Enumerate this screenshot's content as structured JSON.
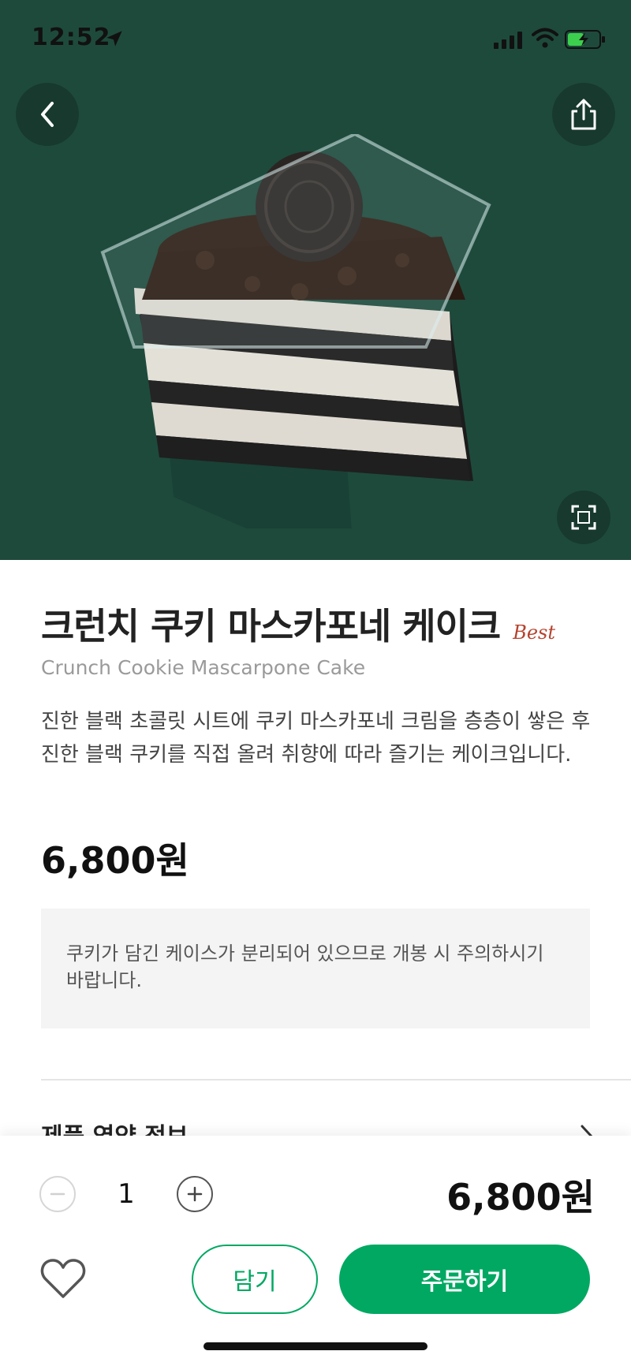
{
  "status_bar": {
    "time": "12:52"
  },
  "product": {
    "name_ko": "크런치 쿠키 마스카포네 케이크",
    "badge": "Best",
    "name_en": "Crunch Cookie Mascarpone Cake",
    "description": "진한 블랙 초콜릿 시트에 쿠키 마스카포네 크림을 층층이 쌓은 후 진한 블랙 쿠키를 직접 올려 취향에 따라 즐기는 케이크입니다.",
    "price": "6,800원",
    "notice": "쿠키가 담긴 케이스가 분리되어 있으므로 개봉 시 주의하시기 바랍니다."
  },
  "nutrition": {
    "label": "제품 영양 정보"
  },
  "order_bar": {
    "quantity": "1",
    "total": "6,800원",
    "cart_label": "담기",
    "order_label": "주문하기"
  },
  "colors": {
    "hero_bg": "#1e4a3c",
    "accent": "#00a862",
    "badge": "#b5432e"
  },
  "icons": [
    "location-arrow-icon",
    "signal-icon",
    "wifi-icon",
    "battery-icon",
    "back-icon",
    "share-icon",
    "fullscreen-icon",
    "chevron-right-icon",
    "minus-icon",
    "plus-icon",
    "heart-icon"
  ]
}
